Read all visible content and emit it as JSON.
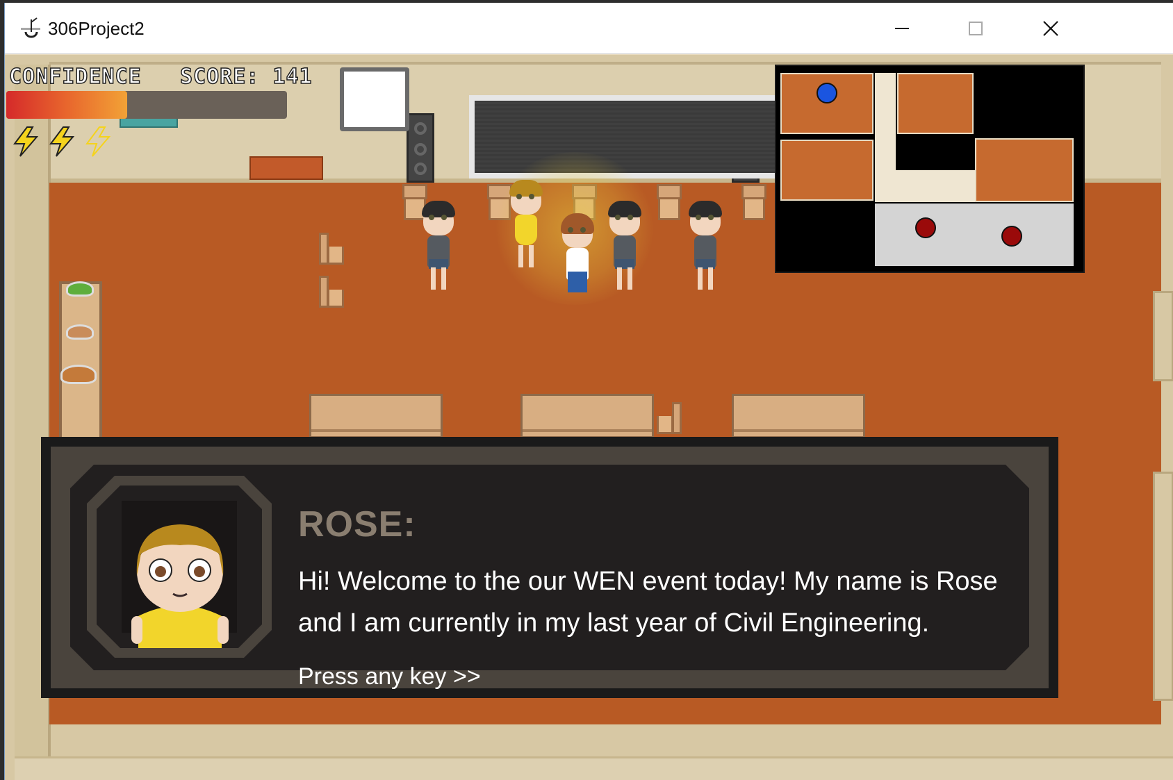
{
  "window": {
    "title": "306Project2",
    "icon": "app-logo-icon",
    "controls": [
      "minimize-icon",
      "maximize-icon",
      "close-icon"
    ]
  },
  "hud": {
    "confidence_label": "CONFIDENCE",
    "score_label": "SCORE: 141",
    "confidence_level": 0.43,
    "energy_bolts_total": 3,
    "energy_bolts_filled": 2,
    "colors": {
      "bar_start": "#d52a2a",
      "bar_end": "#f2a236",
      "bolt": "#f5d31c"
    }
  },
  "minimap": {
    "player_dot_color": "#1a55e0",
    "npc_dot_color": "#9a0a0a"
  },
  "dialog": {
    "speaker": "ROSE:",
    "text": "Hi! Welcome to the our WEN event today! My name is Rose and I am currently in my last year of Civil Engineering.",
    "prompt": "Press any key >>",
    "colors": {
      "speaker": "#8a7e70",
      "text": "#ffffff",
      "panel": "#221f1f"
    }
  }
}
